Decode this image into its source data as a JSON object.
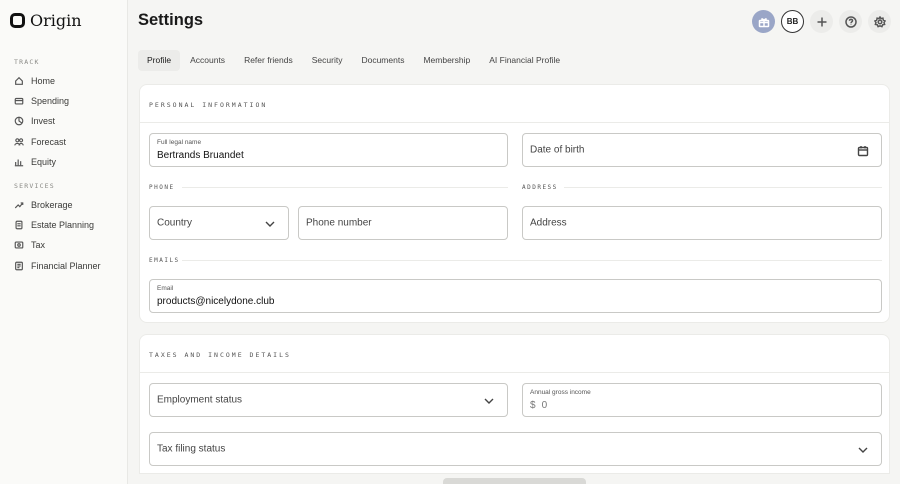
{
  "app": {
    "logo_text": "Origin"
  },
  "sidebar": {
    "track_label": "TRACK",
    "track_items": [
      {
        "label": "Home",
        "icon": "home-icon"
      },
      {
        "label": "Spending",
        "icon": "card-icon"
      },
      {
        "label": "Invest",
        "icon": "pie-icon"
      },
      {
        "label": "Forecast",
        "icon": "people-icon"
      },
      {
        "label": "Equity",
        "icon": "chart-icon"
      }
    ],
    "services_label": "SERVICES",
    "services_items": [
      {
        "label": "Brokerage",
        "icon": "trend-icon"
      },
      {
        "label": "Estate Planning",
        "icon": "document-icon"
      },
      {
        "label": "Tax",
        "icon": "receipt-icon"
      },
      {
        "label": "Financial Planner",
        "icon": "planner-icon"
      }
    ]
  },
  "header": {
    "title": "Settings",
    "avatar_initials": "BB"
  },
  "tabs": [
    {
      "label": "Profile",
      "active": true
    },
    {
      "label": "Accounts",
      "active": false
    },
    {
      "label": "Refer friends",
      "active": false
    },
    {
      "label": "Security",
      "active": false
    },
    {
      "label": "Documents",
      "active": false
    },
    {
      "label": "Membership",
      "active": false
    },
    {
      "label": "AI Financial Profile",
      "active": false
    }
  ],
  "personal": {
    "section_title": "PERSONAL INFORMATION",
    "legal_name_label": "Full legal name",
    "legal_name_value": "Bertrands Bruandet",
    "dob_placeholder": "Date of birth",
    "phone_label": "PHONE",
    "address_label": "ADDRESS",
    "country_placeholder": "Country",
    "phone_placeholder": "Phone number",
    "address_placeholder": "Address",
    "emails_label": "EMAILS",
    "email_label": "Email",
    "email_value": "products@nicelydone.club"
  },
  "taxes": {
    "section_title": "TAXES AND INCOME DETAILS",
    "employment_placeholder": "Employment status",
    "income_label": "Annual gross income",
    "income_currency": "$",
    "income_value": "0",
    "filing_placeholder": "Tax filing status"
  }
}
